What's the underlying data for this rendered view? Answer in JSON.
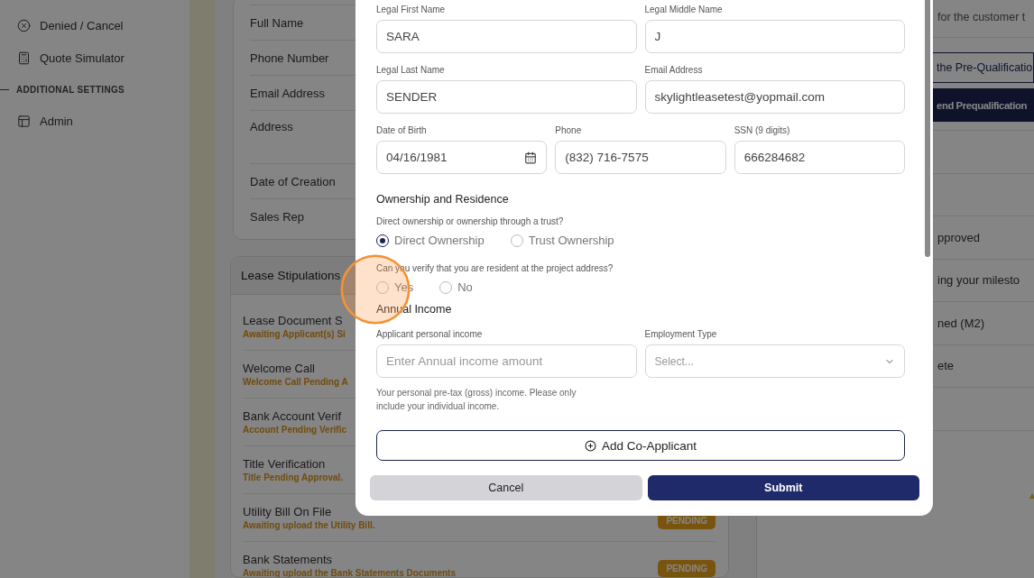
{
  "sidebar": {
    "items": [
      {
        "label": "Denied / Cancel"
      },
      {
        "label": "Quote Simulator"
      }
    ],
    "section": "ADDITIONAL SETTINGS",
    "section_items": [
      {
        "label": "Admin"
      }
    ]
  },
  "customer_card": {
    "rows": [
      {
        "label": "Full Name",
        "tall": false
      },
      {
        "label": "Phone Number",
        "tall": false
      },
      {
        "label": "Email Address",
        "tall": false
      },
      {
        "label": "Address",
        "tall": true
      },
      {
        "label": "Date of Creation",
        "tall": false
      },
      {
        "label": "Sales Rep",
        "tall": false
      }
    ]
  },
  "stipulations": {
    "title": "Lease Stipulations",
    "items": [
      {
        "title": "Lease Document S",
        "status": "Awaiting Applicant(s) Si"
      },
      {
        "title": "Welcome Call",
        "status": "Welcome Call Pending A"
      },
      {
        "title": "Bank Account Verif",
        "status": "Account Pending Verific"
      },
      {
        "title": "Title Verification",
        "status": "Title Pending Approval."
      },
      {
        "title": "Utility Bill On File",
        "status": "Awaiting upload the Utility Bill.",
        "badge": "PENDING"
      },
      {
        "title": "Bank Statements",
        "status": "Awaiting upload the Bank Statements Documents",
        "badge": "PENDING"
      }
    ]
  },
  "right_panel": {
    "note": "for the customer t",
    "buttons": [
      {
        "label": "the Pre-Qualificatio",
        "kind": "outline"
      },
      {
        "label": "end Prequalification",
        "kind": "filled"
      }
    ],
    "rows": [
      "",
      "",
      "pproved",
      "ing your milesto",
      "ned (M2)",
      "ete",
      ""
    ]
  },
  "modal": {
    "fields": [
      {
        "label": "Legal First Name",
        "value": "SARA"
      },
      {
        "label": "Legal Middle Name",
        "value": "J"
      },
      {
        "label": "Legal Last Name",
        "value": "SENDER"
      },
      {
        "label": "Email Address",
        "value": "skylightleasetest@yopmail.com"
      }
    ],
    "fields3": [
      {
        "label": "Date of Birth",
        "value": "04/16/1981",
        "kind": "date"
      },
      {
        "label": "Phone",
        "value": "(832) 716-7575",
        "kind": "text"
      },
      {
        "label": "SSN (9 digits)",
        "value": "666284682",
        "kind": "text"
      }
    ],
    "section1": "Ownership and Residence",
    "questions": [
      {
        "text": "Direct ownership or ownership through a trust?",
        "options": [
          {
            "label": "Direct Ownership",
            "selected": true
          },
          {
            "label": "Trust Ownership",
            "selected": false
          }
        ]
      },
      {
        "text": "Can you verify that you are resident at the project address?",
        "options": [
          {
            "label": "Yes",
            "selected": false
          },
          {
            "label": "No",
            "selected": false
          }
        ]
      }
    ],
    "section2": "Annual Income",
    "income": {
      "label": "Applicant personal income",
      "placeholder": "Enter Annual income amount",
      "help": "Your personal pre-tax (gross) income. Please only include your individual income."
    },
    "employment": {
      "label": "Employment Type",
      "placeholder": "Select..."
    },
    "add_button": "Add Co-Applicant",
    "cancel": "Cancel",
    "submit": "Submit"
  }
}
